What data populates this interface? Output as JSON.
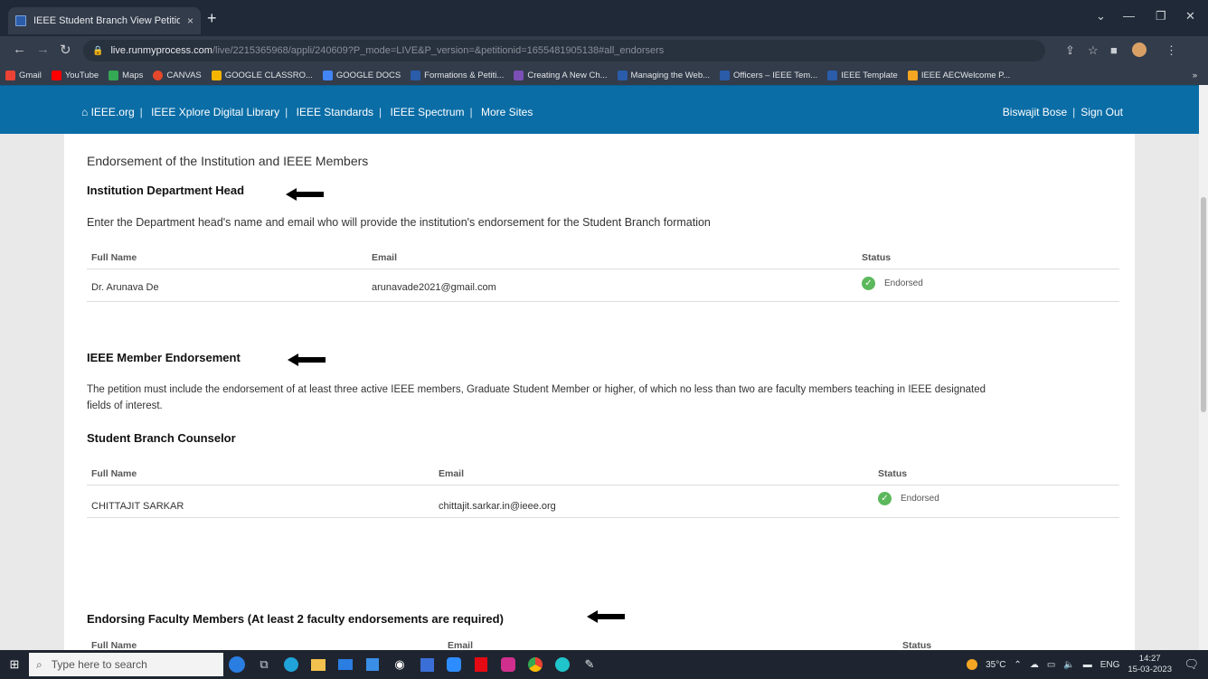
{
  "browser": {
    "tab_title": "IEEE Student Branch View Petition",
    "tab_close": "×",
    "new_tab": "+",
    "url_host": "live.runmyprocess.com",
    "url_path": "/live/2215365968/appli/240609?P_mode=LIVE&P_version=&petitionid=1655481905138#all_endorsers",
    "bookmarks": [
      {
        "label": "Gmail",
        "color": "#ea4335"
      },
      {
        "label": "YouTube",
        "color": "#ff0000"
      },
      {
        "label": "Maps",
        "color": "#34a853"
      },
      {
        "label": "CANVAS",
        "color": "#e4472b"
      },
      {
        "label": "GOOGLE CLASSRO...",
        "color": "#f4b400"
      },
      {
        "label": "GOOGLE DOCS",
        "color": "#4285f4"
      },
      {
        "label": "Formations & Petiti...",
        "color": "#2a5caa"
      },
      {
        "label": "Creating A New Ch...",
        "color": "#7b4fb5"
      },
      {
        "label": "Managing the Web...",
        "color": "#2a5caa"
      },
      {
        "label": "Officers – IEEE Tem...",
        "color": "#2a5caa"
      },
      {
        "label": "IEEE Template",
        "color": "#2a5caa"
      },
      {
        "label": "IEEE AECWelcome P...",
        "color": "#f5a623"
      }
    ]
  },
  "ieee_nav": {
    "links": [
      "IEEE.org",
      "IEEE Xplore Digital Library",
      "IEEE Standards",
      "IEEE Spectrum",
      "More Sites"
    ],
    "user": "Biswajit Bose",
    "sign_out": "Sign Out"
  },
  "page": {
    "section_title": "Endorsement of the Institution and IEEE Members",
    "dept_heading": "Institution Department Head",
    "dept_desc": "Enter the Department head's name and email who will provide the institution's endorsement for the Student Branch formation",
    "columns": {
      "name": "Full Name",
      "email": "Email",
      "status": "Status"
    },
    "dept_row": {
      "name": "Dr. Arunava De",
      "email": "arunavade2021@gmail.com",
      "status": "Endorsed"
    },
    "member_heading": "IEEE Member Endorsement",
    "member_desc_1": "The petition must include the endorsement of at least three active IEEE members, Graduate Student Member or higher, of which no less than two are faculty members teaching in IEEE designated",
    "member_desc_2": "fields of interest.",
    "counselor_heading": "Student Branch Counselor",
    "counselor_row": {
      "name": "CHITTAJIT SARKAR",
      "email": "chittajit.sarkar.in@ieee.org",
      "status": "Endorsed"
    },
    "faculty_heading": "Endorsing Faculty Members (At least 2 faculty endorsements are required)"
  },
  "taskbar": {
    "search_placeholder": "Type here to search",
    "temperature": "35°C",
    "language": "ENG",
    "time": "14:27",
    "date": "15-03-2023"
  }
}
